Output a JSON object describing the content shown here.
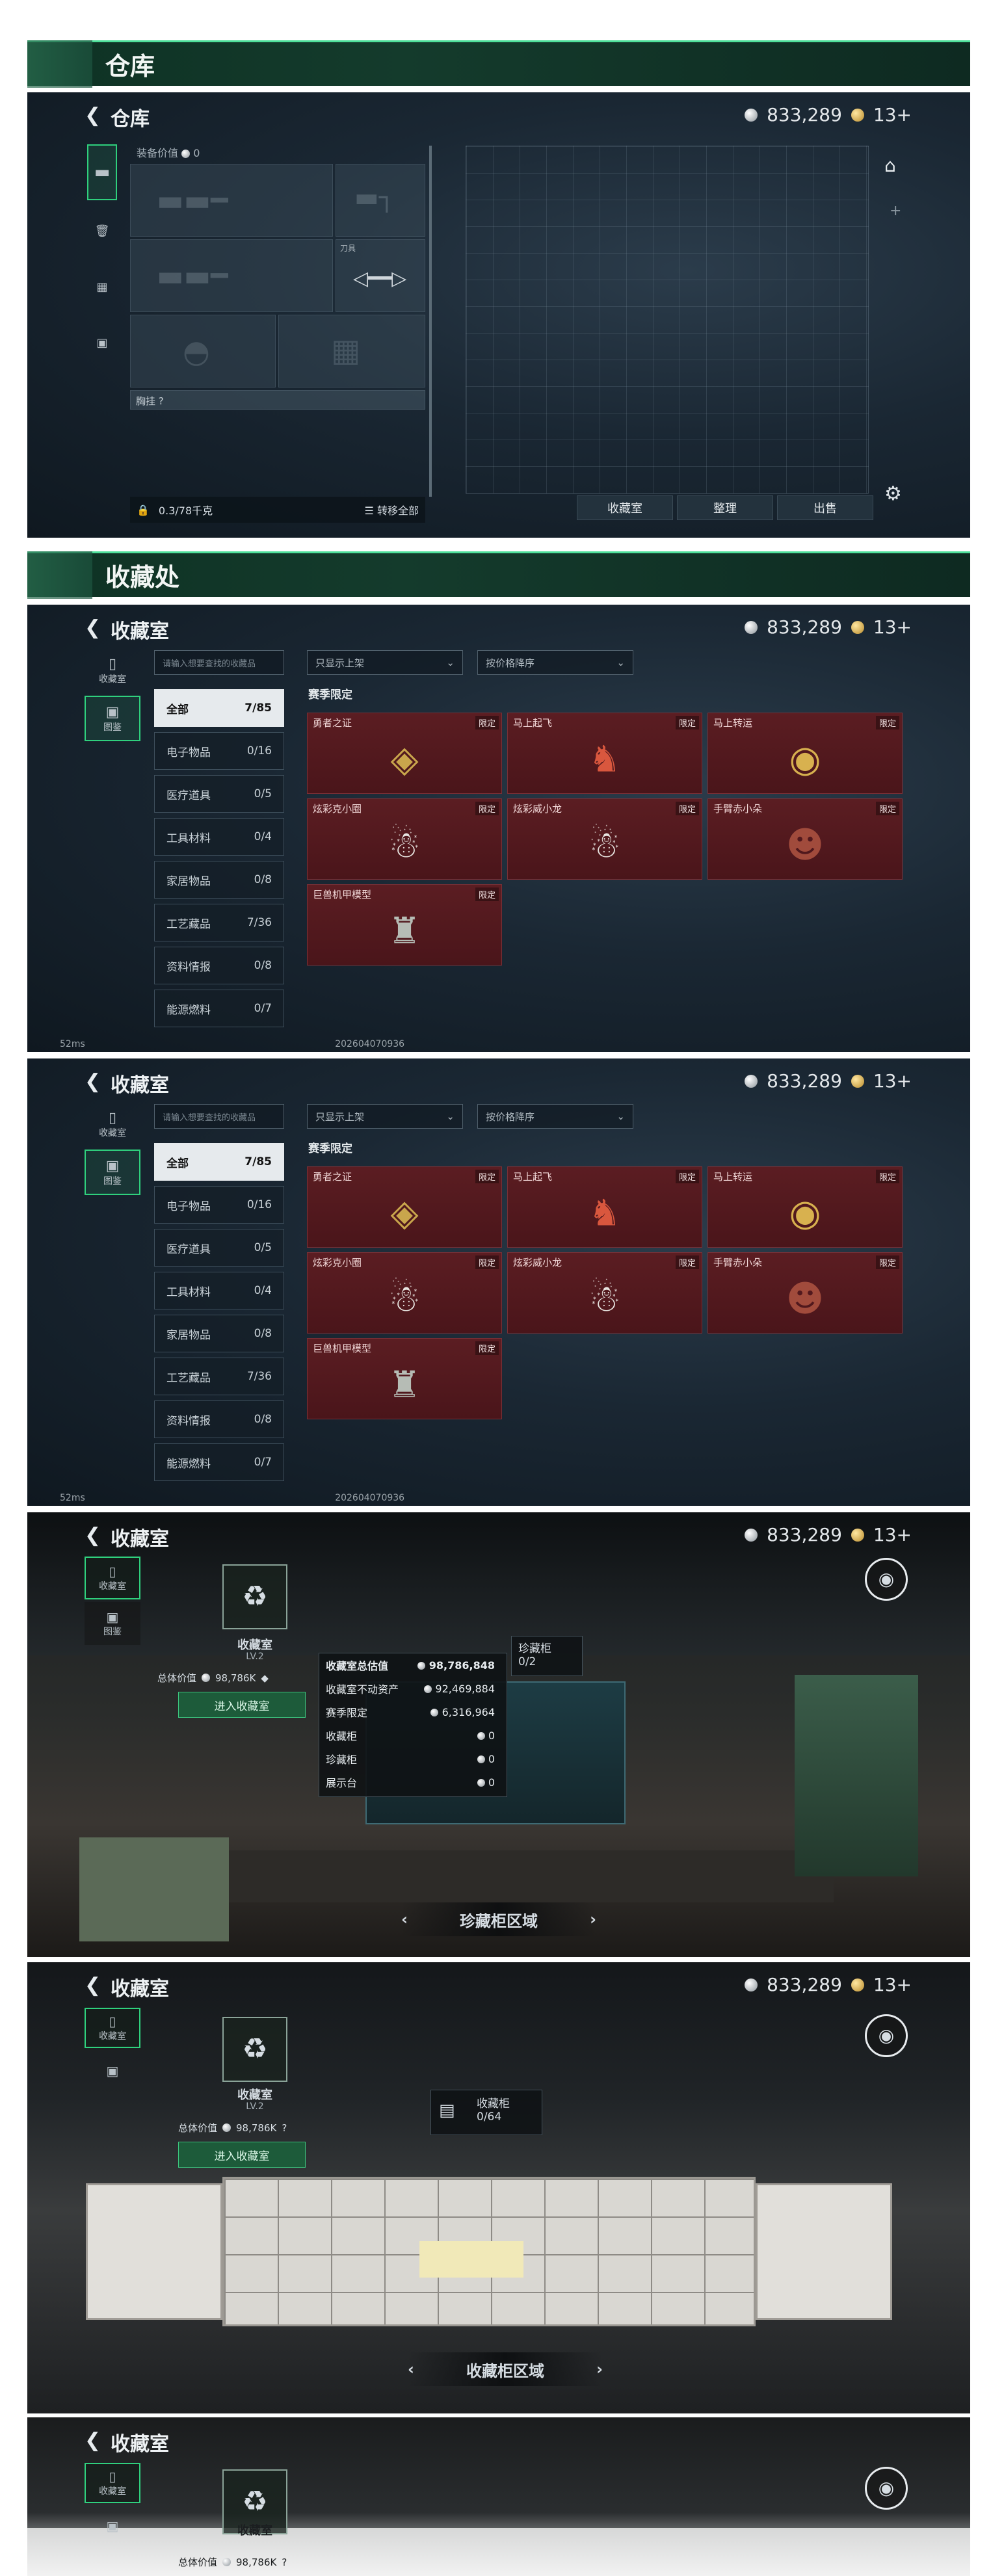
{
  "warehouse": {
    "header": "仓库",
    "title": "仓库",
    "silver": "833,289",
    "gold": "13+",
    "equip_value": "装备价值",
    "equip_value_num": "0",
    "knife_label": "刀具",
    "chest_label": "胸挂",
    "chest_q": "?",
    "capacity": "0.3/78千克",
    "transfer_all": "转移全部",
    "tabs": [
      "收藏室",
      "整理",
      "出售"
    ],
    "plus": "+"
  },
  "collection": {
    "header": "收藏处",
    "title": "收藏室",
    "silver": "833,289",
    "gold": "13+",
    "side_tabs": [
      "收藏室",
      "图鉴"
    ],
    "search_placeholder": "请输入想要查找的收藏品",
    "filter1": "只显示上架",
    "filter2": "按价格降序",
    "section": "赛季限定",
    "categories": [
      {
        "name": "全部",
        "count": "7/85"
      },
      {
        "name": "电子物品",
        "count": "0/16"
      },
      {
        "name": "医疗道具",
        "count": "0/5"
      },
      {
        "name": "工具材料",
        "count": "0/4"
      },
      {
        "name": "家居物品",
        "count": "0/8"
      },
      {
        "name": "工艺藏品",
        "count": "7/36"
      },
      {
        "name": "资料情报",
        "count": "0/8"
      },
      {
        "name": "能源燃料",
        "count": "0/7"
      }
    ],
    "items": [
      {
        "name": "勇者之证",
        "tag": "限定",
        "icon": "badge"
      },
      {
        "name": "马上起飞",
        "tag": "限定",
        "icon": "horse"
      },
      {
        "name": "马上转运",
        "tag": "限定",
        "icon": "coin"
      },
      {
        "name": "炫彩克小圈",
        "tag": "限定",
        "icon": "figure"
      },
      {
        "name": "炫彩威小龙",
        "tag": "限定",
        "icon": "figure"
      },
      {
        "name": "手臂赤小朵",
        "tag": "限定",
        "icon": "figure"
      },
      {
        "name": "巨兽机甲模型",
        "tag": "限定",
        "icon": "mech"
      }
    ],
    "footer_ping": "52ms",
    "footer_id": "202604070936"
  },
  "room1": {
    "title": "收藏室",
    "silver": "833,289",
    "gold": "13+",
    "side_tabs": [
      "收藏室",
      "图鉴"
    ],
    "icon_label": "收藏室",
    "level": "LV.2",
    "total_label": "总体价值",
    "total_value": "98,786K",
    "enter": "进入收藏室",
    "stats_title": "收藏室总估值",
    "stats_title_value": "98,786,848",
    "stats": [
      {
        "label": "收藏室不动资产",
        "value": "92,469,884"
      },
      {
        "label": "赛季限定",
        "value": "6,316,964"
      },
      {
        "label": "收藏柜",
        "value": "0"
      },
      {
        "label": "珍藏柜",
        "value": "0"
      },
      {
        "label": "展示台",
        "value": "0"
      }
    ],
    "cabinet_label": "珍藏柜",
    "cabinet_count": "0/2",
    "area": "珍藏柜区域"
  },
  "room2": {
    "title": "收藏室",
    "silver": "833,289",
    "gold": "13+",
    "icon_label": "收藏室",
    "level": "LV.2",
    "total_label": "总体价值",
    "total_value": "98,786K",
    "q": "?",
    "enter": "进入收藏室",
    "cabinet_label": "收藏柜",
    "cabinet_count": "0/64",
    "area": "收藏柜区域",
    "side_tabs": [
      "收藏室",
      "图鉴"
    ]
  },
  "room3": {
    "title": "收藏室",
    "icon_label": "收藏室",
    "total_label": "总体价值",
    "total_value": "98,786K",
    "q": "?",
    "side_tabs": [
      "收藏室",
      "图鉴"
    ]
  }
}
